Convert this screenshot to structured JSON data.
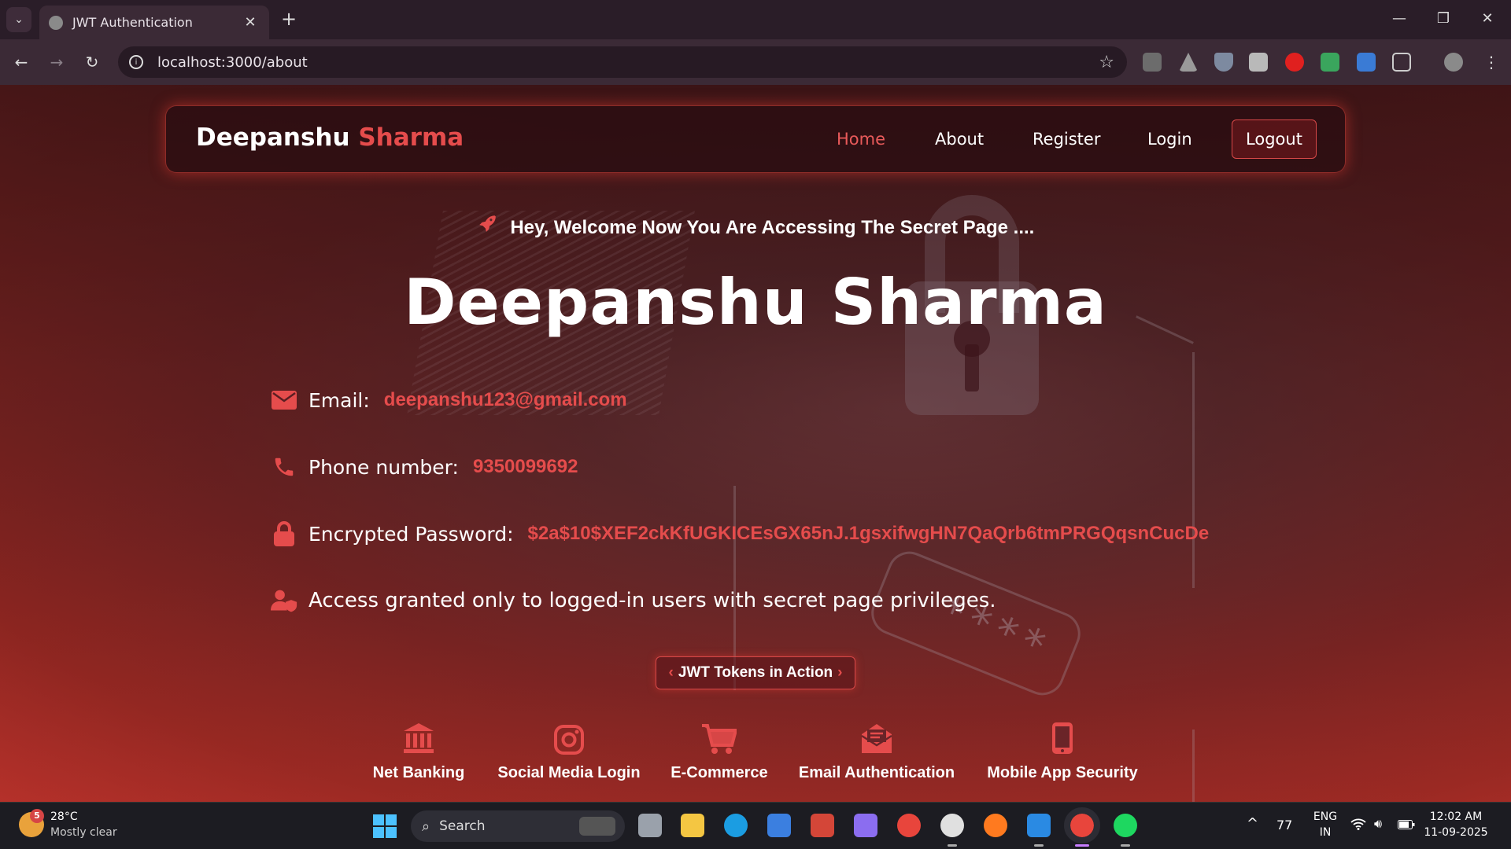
{
  "browser": {
    "tab_title": "JWT Authentication",
    "tab_close": "✕",
    "new_tab": "+",
    "url": "localhost:3000/about",
    "window_controls": {
      "minimize": "—",
      "restore": "❐",
      "close": "✕"
    },
    "nav": {
      "back": "←",
      "forward": "→",
      "reload": "↻",
      "bookmark": "☆"
    }
  },
  "site": {
    "brand_first": "Deepanshu",
    "brand_last": "Sharma",
    "menu": [
      {
        "label": "Home",
        "active": true
      },
      {
        "label": "About",
        "active": false
      },
      {
        "label": "Register",
        "active": false
      },
      {
        "label": "Login",
        "active": false
      }
    ],
    "logout_label": "Logout",
    "welcome_text": "Hey, Welcome Now You Are Accessing The Secret Page ....",
    "name_heading": "Deepanshu Sharma",
    "email_label": "Email:",
    "email_value": "deepanshu123@gmail.com",
    "phone_label": "Phone number:",
    "phone_value": "9350099692",
    "password_label": "Encrypted Password:",
    "password_value": "$2a$10$XEF2ckKfUGKICEsGX65nJ.1gsxifwgHN7QaQrb6tmPRGQqsnCucDe",
    "access_note": "Access granted only to logged-in users with secret page privileges.",
    "jwt_button": "JWT Tokens in Action",
    "features": [
      {
        "label": "Net Banking",
        "icon": "bank-icon"
      },
      {
        "label": "Social Media Login",
        "icon": "instagram-icon"
      },
      {
        "label": "E-Commerce",
        "icon": "cart-icon"
      },
      {
        "label": "Email Authentication",
        "icon": "envelope-open-icon"
      },
      {
        "label": "Mobile App Security",
        "icon": "mobile-icon"
      }
    ],
    "decor_stars": "****",
    "accent_color": "#e54c4c"
  },
  "taskbar": {
    "weather_badge": "5",
    "weather_temp": "28°C",
    "weather_condition": "Mostly clear",
    "search_placeholder": "Search",
    "tray_count": "77",
    "language": "ENG",
    "region": "IN",
    "time": "12:02 AM",
    "date": "11-09-2025",
    "chevron": "^"
  }
}
